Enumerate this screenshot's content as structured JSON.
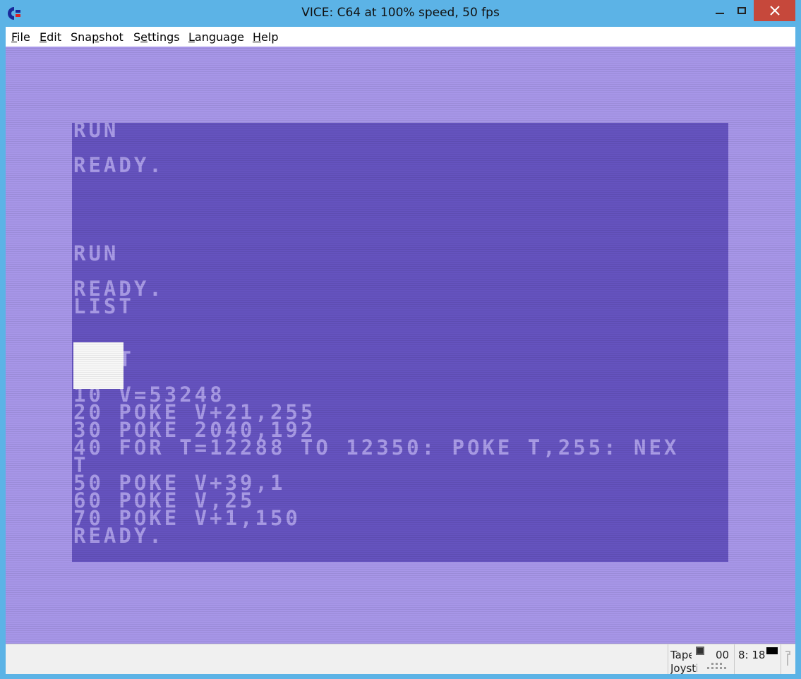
{
  "window": {
    "title": "VICE: C64 at 100% speed, 50 fps",
    "icon": "c64-logo-icon"
  },
  "menu": {
    "items": [
      {
        "label": "File",
        "accel": "F",
        "rest": "ile"
      },
      {
        "label": "Edit",
        "accel": "E",
        "rest": "dit"
      },
      {
        "label": "Snapshot",
        "pre": "Sna",
        "accel": "p",
        "rest": "shot"
      },
      {
        "label": "Settings",
        "pre": "S",
        "accel": "e",
        "rest": "ttings"
      },
      {
        "label": "Language",
        "accel": "L",
        "rest": "anguage"
      },
      {
        "label": "Help",
        "accel": "H",
        "rest": "elp"
      }
    ]
  },
  "c64_screen": {
    "lines": [
      "RUN",
      "",
      "READY.",
      "",
      "",
      "",
      "",
      "RUN",
      "",
      "READY.",
      "LIST",
      "",
      "",
      "   T",
      "",
      "10 V=53248",
      "20 POKE V+21,255",
      "30 POKE 2040,192",
      "40 FOR T=12288 TO 12350: POKE T,255: NEX",
      "T",
      "50 POKE V+39,1",
      "60 POKE V,25",
      "70 POKE V+1,150",
      "READY."
    ],
    "colors": {
      "border": "#a796e8",
      "background": "#6553bf",
      "text": "#a99be6",
      "sprite": "#f7f7f7"
    }
  },
  "statusbar": {
    "tape_label": "Tape",
    "tape_counter": "00",
    "drive_label": "8: 18",
    "joystick_label": "Joystick"
  }
}
